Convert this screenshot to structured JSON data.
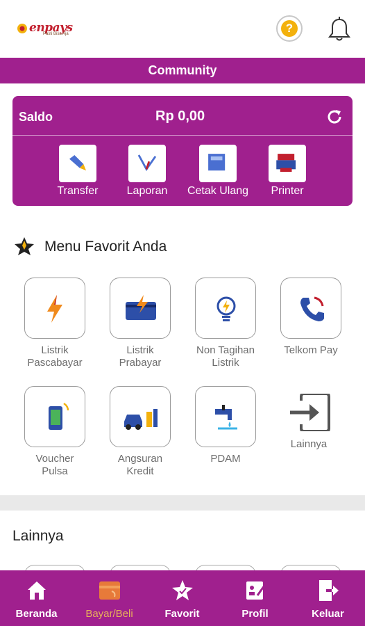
{
  "header": {
    "logo_text": "enpays",
    "logo_tagline": "Pasti Bisa Aja",
    "help_glyph": "?"
  },
  "community_bar": {
    "label": "Community"
  },
  "saldo": {
    "label": "Saldo",
    "value": "Rp 0,00",
    "actions": [
      {
        "label": "Transfer",
        "icon": "transfer-icon"
      },
      {
        "label": "Laporan",
        "icon": "report-icon"
      },
      {
        "label": "Cetak Ulang",
        "icon": "reprint-icon"
      },
      {
        "label": "Printer",
        "icon": "printer-icon"
      }
    ]
  },
  "favorites": {
    "title": "Menu Favorit Anda",
    "items": [
      {
        "label": "Listrik\nPascabayar",
        "icon": "lightning-icon"
      },
      {
        "label": "Listrik\nPrabayar",
        "icon": "prepaid-electric-icon"
      },
      {
        "label": "Non Tagihan\nListrik",
        "icon": "lightbulb-icon"
      },
      {
        "label": "Telkom Pay",
        "icon": "phone-icon"
      },
      {
        "label": "Voucher\nPulsa",
        "icon": "mobile-icon"
      },
      {
        "label": "Angsuran\nKredit",
        "icon": "car-installment-icon"
      },
      {
        "label": "PDAM",
        "icon": "water-tap-icon"
      },
      {
        "label": "Lainnya",
        "icon": "login-arrow-icon"
      }
    ]
  },
  "others": {
    "title": "Lainnya"
  },
  "bottom_nav": {
    "items": [
      {
        "label": "Beranda",
        "icon": "home-icon"
      },
      {
        "label": "Bayar/Beli",
        "icon": "pay-icon",
        "active": true
      },
      {
        "label": "Favorit",
        "icon": "star-icon"
      },
      {
        "label": "Profil",
        "icon": "profile-icon"
      },
      {
        "label": "Keluar",
        "icon": "logout-icon"
      }
    ]
  },
  "colors": {
    "brand_purple": "#a0208e",
    "accent_orange": "#f3b10d",
    "active_nav": "#e8b15a"
  }
}
